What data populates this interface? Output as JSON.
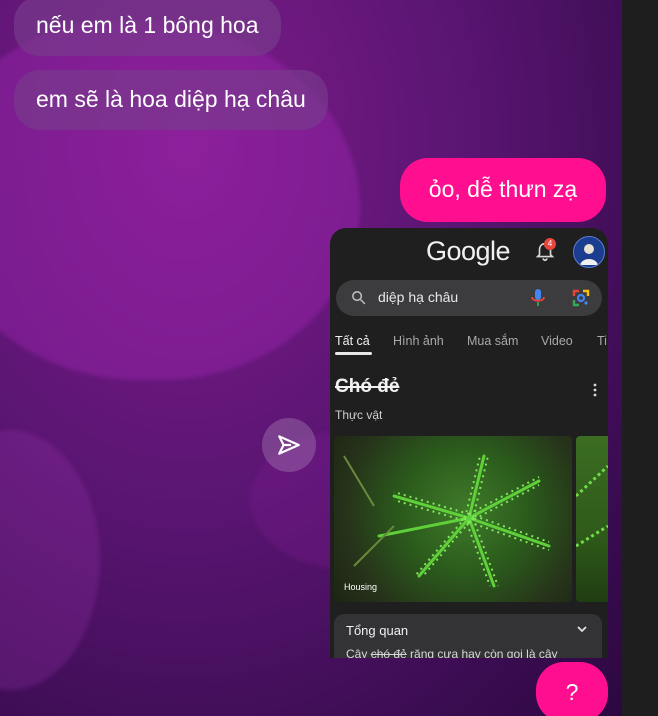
{
  "messages": {
    "incoming": [
      "nếu em là 1 bông hoa",
      "em sẽ là hoa diệp hạ châu"
    ],
    "outgoing_reply": "ỏo, dễ thưn zạ",
    "outgoing_question": "?"
  },
  "colors": {
    "outgoing_bubble": "#ff0f8f",
    "incoming_bubble": "#784a8c",
    "chat_background": "#5a1572",
    "screenshot_background": "#1f1f1f"
  },
  "shared_screenshot": {
    "logo": "Google",
    "notification_count": "4",
    "search_query": "diệp hạ châu",
    "tabs": [
      "Tất cả",
      "Hình ảnh",
      "Mua sắm",
      "Video",
      "Ti"
    ],
    "active_tab": "Tất cả",
    "knowledge_panel": {
      "title": "Chó đẻ",
      "subtitle": "Thực vật",
      "image_caption": "Housing",
      "overview_label": "Tổng quan",
      "snippet_prefix": "Cây ",
      "snippet_struck": "chó đẻ",
      "snippet_suffix": " răng cưa hay còn gọi là cây"
    }
  },
  "icons": {
    "send": "paper-plane-icon",
    "search": "search-icon",
    "mic": "mic-icon",
    "lens": "lens-icon",
    "bell": "bell-icon",
    "more": "more-vert-icon",
    "expand": "chevron-down-icon"
  }
}
